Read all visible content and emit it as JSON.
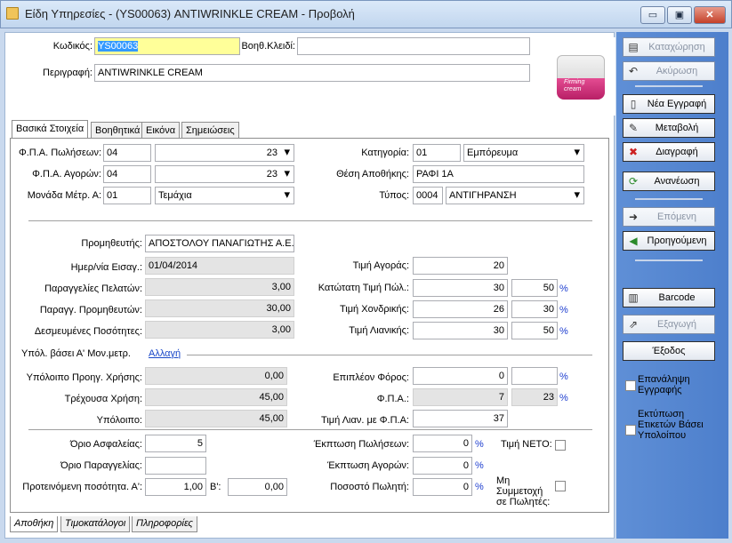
{
  "window": {
    "title": "Είδη Υπηρεσίες - (YS00063) ANTIWRINKLE CREAM -  Προβολή",
    "minimize": "▭",
    "restore": "▣",
    "close": "✕"
  },
  "header": {
    "code_label": "Κωδικός:",
    "code_value": "YS00063",
    "aux_key_label": "Βοηθ.Κλειδί:",
    "aux_key_value": "",
    "description_label": "Περιγραφή:",
    "description_value": "ANTIWRINKLE CREAM",
    "product_image_text": "Firming cream"
  },
  "tabs": [
    "Βασικά Στοιχεία",
    "Βοηθητικά",
    "Εικόνα",
    "Σημειώσεις"
  ],
  "basic": {
    "vat_sales_label": "Φ.Π.Α. Πωλήσεων:",
    "vat_sales_code": "04",
    "vat_sales_value": "23",
    "vat_purch_label": "Φ.Π.Α. Αγορών:",
    "vat_purch_code": "04",
    "vat_purch_value": "23",
    "unit_label": "Μονάδα Μέτρ. Α:",
    "unit_code": "01",
    "unit_value": "Τεμάχια",
    "category_label": "Κατηγορία:",
    "category_code": "01",
    "category_value": "Εμπόρευμα",
    "storage_label": "Θέση Αποθήκης:",
    "storage_value": "ΡΑΦΙ 1Α",
    "type_label": "Τύπος:",
    "type_code": "0004",
    "type_value": "ΑΝΤΙΓΗΡΑΝΣΗ",
    "supplier_label": "Προμηθευτής:",
    "supplier_value": "ΑΠΟΣΤΟΛΟΥ ΠΑΝΑΓΙΩΤΗΣ Α.Ε.",
    "import_date_label": "Ημερ/νία Εισαγ.:",
    "import_date_value": "01/04/2014",
    "cust_orders_label": "Παραγγελίες Πελατών:",
    "cust_orders_value": "3,00",
    "supp_orders_label": "Παραγγ. Προμηθευτών:",
    "supp_orders_value": "30,00",
    "reserved_label": "Δεσμευμένες Ποσότητες:",
    "reserved_value": "3,00",
    "purchase_price_label": "Τιμή Αγοράς:",
    "purchase_price_value": "20",
    "min_sale_label": "Κατώτατη Τιμή Πώλ.:",
    "min_sale_value": "30",
    "min_sale_pct": "50",
    "wholesale_label": "Τιμή Χονδρικής:",
    "wholesale_value": "26",
    "wholesale_pct": "30",
    "retail_label": "Τιμή Λιανικής:",
    "retail_value": "30",
    "retail_pct": "50",
    "pct_symbol": "%",
    "balance_section_label": "Υπόλ. βάσει Α' Μον.μετρ.",
    "change_link": "Αλλαγή",
    "prev_year_label": "Υπόλοιπο Προηγ. Χρήσης:",
    "prev_year_value": "0,00",
    "current_year_label": "Τρέχουσα Χρήση:",
    "current_year_value": "45,00",
    "balance_label": "Υπόλοιπο:",
    "balance_value": "45,00",
    "extra_tax_label": "Επιπλέον Φόρος:",
    "extra_tax_value": "0",
    "extra_tax_pct": "",
    "vat_label": "Φ.Π.Α.:",
    "vat_value": "7",
    "vat_pct": "23",
    "retail_vat_label": "Τιμή Λιαν. με Φ.Π.Α:",
    "retail_vat_value": "37",
    "safety_limit_label": "Όριο Ασφαλείας:",
    "safety_limit_value": "5",
    "order_limit_label": "Όριο Παραγγελίας:",
    "order_limit_value": "",
    "suggested_qty_label": "Προτεινόμενη ποσότητα. Α':",
    "suggested_qty_value": "1,00",
    "b_label": "Β':",
    "b_value": "0,00",
    "sales_discount_label": "Έκπτωση Πωλήσεων:",
    "sales_discount_value": "0",
    "purch_discount_label": "Έκπτωση Αγορών:",
    "purch_discount_value": "0",
    "seller_pct_label": "Ποσοστό Πωλητή:",
    "seller_pct_value": "0",
    "net_price_label": "Τιμή  ΝΕΤΟ:",
    "no_seller_label": "Μη Συμμετοχή σε Πωλητές:"
  },
  "bottom_tabs": [
    "Αποθήκη",
    "Τιμοκατάλογοι",
    "Πληροφορίες"
  ],
  "actions": {
    "save": "Καταχώρηση",
    "cancel": "Ακύρωση",
    "new": "Νέα Εγγραφή",
    "edit": "Μεταβολή",
    "delete": "Διαγραφή",
    "refresh": "Ανανέωση",
    "next": "Επόμενη",
    "previous": "Προηγούμενη",
    "barcode": "Barcode",
    "export": "Εξαγωγή",
    "exit": "Έξοδος",
    "repeat_entry": "Επανάληψη Εγγραφής",
    "print_labels": "Εκτύπωση Ετικετών Βάσει Υπολοίπου"
  },
  "colors": {
    "accent_panel": "#5585d0",
    "highlight_input": "#ffff99",
    "percent_blue": "#1f3fd0"
  }
}
